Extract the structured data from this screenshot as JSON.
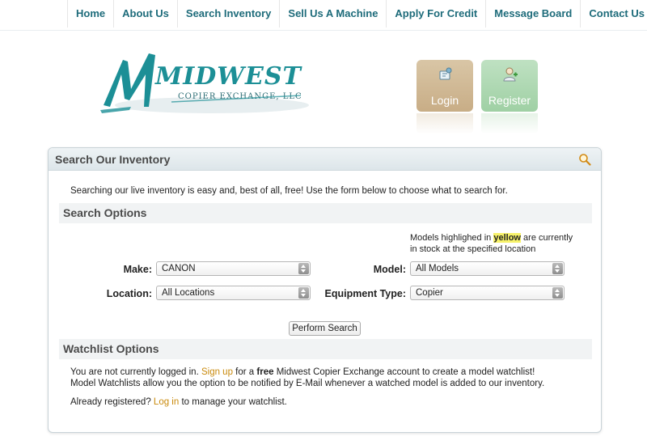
{
  "nav": {
    "items": [
      "Home",
      "About Us",
      "Search Inventory",
      "Sell Us A Machine",
      "Apply For Credit",
      "Message Board",
      "Contact Us"
    ]
  },
  "logo": {
    "main": "MIDWEST",
    "sub": "COPIER EXCHANGE, LLC"
  },
  "account": {
    "login_label": "Login",
    "register_label": "Register"
  },
  "panel": {
    "title": "Search Our Inventory",
    "intro": "Searching our live inventory is easy and, best of all, free! Use the form below to choose what to search for.",
    "search_options": {
      "title": "Search Options",
      "note_prefix": "Models highlighed in ",
      "note_highlight": "yellow",
      "note_suffix": " are currently",
      "note_line2": "in stock at the specified location",
      "make_label": "Make:",
      "make_value": "CANON",
      "model_label": "Model:",
      "model_value": "All Models",
      "location_label": "Location:",
      "location_value": "All Locations",
      "equipment_label": "Equipment Type:",
      "equipment_value": "Copier",
      "search_button": "Perform Search"
    },
    "watchlist": {
      "title": "Watchlist Options",
      "line1_a": "You are not currently logged in. ",
      "signup_link": "Sign up",
      "line1_b": " for a ",
      "line1_free": "free",
      "line1_c": " Midwest Copier Exchange account to create a model watchlist!",
      "line2": "Model Watchlists allow you the option to be notified by E-Mail whenever a watched model is added to our inventory.",
      "line3_a": "Already registered? ",
      "login_link": "Log in",
      "line3_b": " to manage your watchlist."
    }
  },
  "colors": {
    "nav_text": "#1d6b7a",
    "logo_teal": "#1c8f96",
    "link": "#c98a0c",
    "highlight": "#f7f26a"
  }
}
